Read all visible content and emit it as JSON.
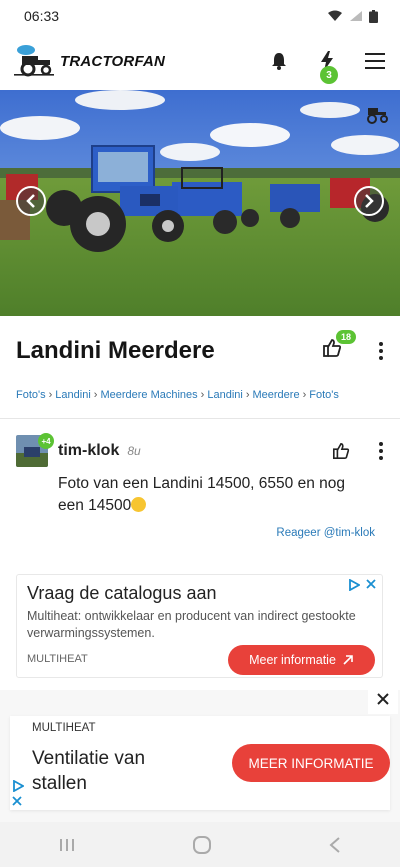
{
  "status": {
    "time": "06:33",
    "icons": [
      "wifi-icon",
      "signal-icon",
      "battery-icon"
    ]
  },
  "header": {
    "brand": "TRACTORFAN",
    "notifications_icon": "bell-icon",
    "activity_icon": "bolt-icon",
    "activity_badge": "3",
    "menu_icon": "hamburger-icon"
  },
  "hero": {
    "prev_icon": "chevron-left-icon",
    "next_icon": "chevron-right-icon",
    "watermark": "tractor-logo-icon"
  },
  "page": {
    "title": "Landini Meerdere",
    "likes": "18"
  },
  "breadcrumb": [
    "Foto's",
    "Landini",
    "Meerdere Machines",
    "Landini",
    "Meerdere",
    "Foto's"
  ],
  "comment": {
    "avatar_badge": "+4",
    "user": "tim-klok",
    "time": "8u",
    "text": "Foto van een Landini 14500, 6550 en nog een 14500",
    "reply": "Reageer @tim-klok"
  },
  "ad": {
    "title": "Vraag de catalogus aan",
    "description": "Multiheat: ontwikkelaar en producent van indirect gestookte verwarmingssystemen.",
    "brand": "MULTIHEAT",
    "cta": "Meer informatie"
  },
  "sticky_ad": {
    "brand": "MULTIHEAT",
    "title": "Ventilatie van stallen",
    "cta": "MEER INFORMATIE"
  },
  "colors": {
    "accent_green": "#5cc334",
    "link_blue": "#2a7ab8",
    "cta_red": "#e8413a"
  }
}
